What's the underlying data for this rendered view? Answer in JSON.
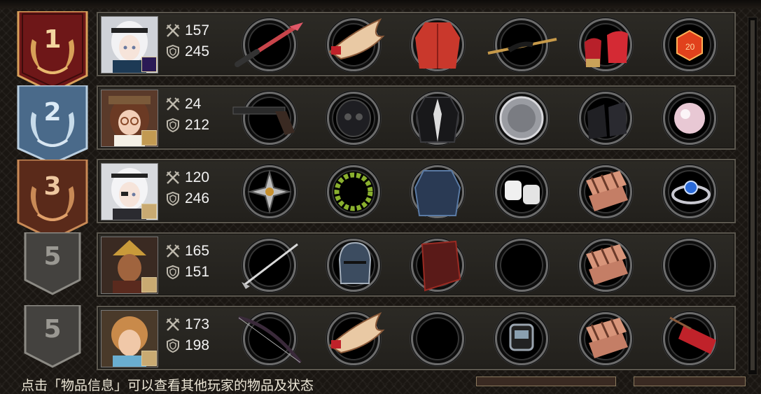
{
  "ranking": [
    {
      "rank_label": "1",
      "tier": "gold-red",
      "attack": "157",
      "defense": "245",
      "avatar": "white-haired-girl-with-headband",
      "equipment": [
        "katana-red-blade",
        "winged-crown",
        "red-jacket",
        "ornate-dagger",
        "red-high-heels",
        "red-d20-die"
      ]
    },
    {
      "rank_label": "2",
      "tier": "silver-blue",
      "attack": "24",
      "defense": "212",
      "avatar": "brown-haired-girl-with-glasses-and-hat",
      "equipment": [
        "revolver-pistol",
        "black-gas-mask-helmet",
        "black-suit",
        "metal-plate-disc",
        "black-gauntlets",
        "pink-pearl"
      ]
    },
    {
      "rank_label": "3",
      "tier": "bronze-brown",
      "attack": "120",
      "defense": "246",
      "avatar": "white-haired-girl-with-eyepatch",
      "equipment": [
        "four-blade-shuriken",
        "laurel-wreath",
        "blue-leather-armor",
        "white-wristbands",
        "striped-bracers",
        "blue-gem-ring"
      ]
    },
    {
      "rank_label": "5",
      "tier": "stone-grey",
      "attack": "165",
      "defense": "151",
      "avatar": "blond-man-with-scar",
      "equipment": [
        "golf-club",
        "knight-helmet",
        "red-cape-armor",
        "",
        "striped-bracers",
        ""
      ]
    },
    {
      "rank_label": "5",
      "tier": "stone-grey",
      "attack": "173",
      "defense": "198",
      "avatar": "orange-haired-young-man",
      "equipment": [
        "recurve-bow",
        "winged-crown",
        "",
        "smart-watch",
        "striped-bracers",
        "red-quiver"
      ]
    }
  ],
  "icons": {
    "attack": "crossed-swords-icon",
    "defense": "shield-icon"
  },
  "hint_text": "点击「物品信息」可以查看其他玩家的物品及状态"
}
